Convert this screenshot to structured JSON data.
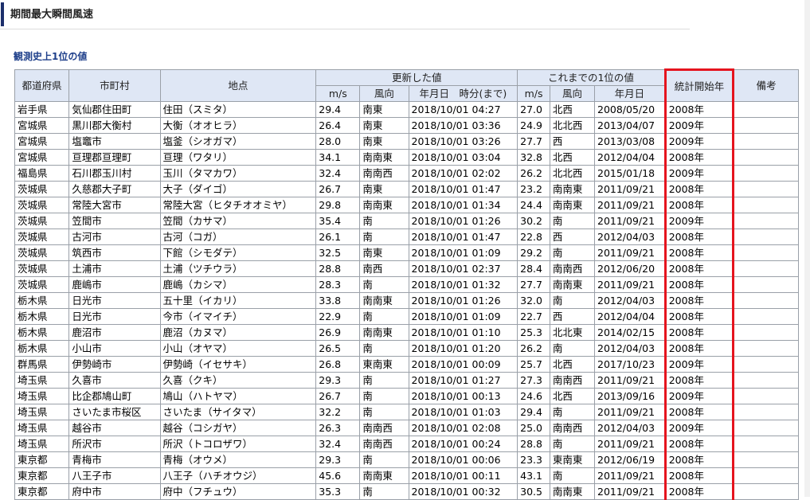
{
  "page": {
    "title": "期間最大瞬間風速",
    "section_title": "観測史上1位の値"
  },
  "colors": {
    "header_bg": "#dfe7f5",
    "title_accent": "#1c2f6b",
    "section_title": "#1e3f8a",
    "highlight": "#e5141e"
  },
  "table": {
    "headers": {
      "prefecture": "都道府県",
      "city": "市町村",
      "station": "地点",
      "updated_group": "更新した値",
      "previous_group": "これまでの1位の値",
      "start_year": "統計開始年",
      "remarks": "備考",
      "updated_speed": "m/s",
      "updated_direction": "風向",
      "updated_datetime": "年月日　時分(まで)",
      "previous_speed": "m/s",
      "previous_direction": "風向",
      "previous_date": "年月日"
    },
    "rows": [
      {
        "prefecture": "岩手県",
        "city": "気仙郡住田町",
        "station": "住田（スミタ）",
        "speed": "29.4",
        "direction": "南東",
        "datetime": "2018/10/01 04:27",
        "prev_speed": "27.0",
        "prev_direction": "北西",
        "prev_date": "2008/05/20",
        "start_year": "2008年",
        "remarks": ""
      },
      {
        "prefecture": "宮城県",
        "city": "黒川郡大衡村",
        "station": "大衡（オオヒラ）",
        "speed": "26.4",
        "direction": "南東",
        "datetime": "2018/10/01 03:36",
        "prev_speed": "24.9",
        "prev_direction": "北北西",
        "prev_date": "2013/04/07",
        "start_year": "2009年",
        "remarks": ""
      },
      {
        "prefecture": "宮城県",
        "city": "塩竈市",
        "station": "塩釜（シオガマ）",
        "speed": "28.0",
        "direction": "南東",
        "datetime": "2018/10/01 03:26",
        "prev_speed": "27.7",
        "prev_direction": "西",
        "prev_date": "2013/03/08",
        "start_year": "2009年",
        "remarks": ""
      },
      {
        "prefecture": "宮城県",
        "city": "亘理郡亘理町",
        "station": "亘理（ワタリ）",
        "speed": "34.1",
        "direction": "南南東",
        "datetime": "2018/10/01 03:04",
        "prev_speed": "32.8",
        "prev_direction": "北西",
        "prev_date": "2012/04/04",
        "start_year": "2008年",
        "remarks": ""
      },
      {
        "prefecture": "福島県",
        "city": "石川郡玉川村",
        "station": "玉川（タマカワ）",
        "speed": "32.4",
        "direction": "南南西",
        "datetime": "2018/10/01 02:02",
        "prev_speed": "26.2",
        "prev_direction": "北北西",
        "prev_date": "2015/01/18",
        "start_year": "2009年",
        "remarks": ""
      },
      {
        "prefecture": "茨城県",
        "city": "久慈郡大子町",
        "station": "大子（ダイゴ）",
        "speed": "26.7",
        "direction": "南東",
        "datetime": "2018/10/01 01:47",
        "prev_speed": "23.2",
        "prev_direction": "南南東",
        "prev_date": "2011/09/21",
        "start_year": "2008年",
        "remarks": ""
      },
      {
        "prefecture": "茨城県",
        "city": "常陸大宮市",
        "station": "常陸大宮（ヒタチオオミヤ）",
        "speed": "29.8",
        "direction": "南南東",
        "datetime": "2018/10/01 01:34",
        "prev_speed": "24.4",
        "prev_direction": "南南東",
        "prev_date": "2011/09/21",
        "start_year": "2008年",
        "remarks": ""
      },
      {
        "prefecture": "茨城県",
        "city": "笠間市",
        "station": "笠間（カサマ）",
        "speed": "35.4",
        "direction": "南",
        "datetime": "2018/10/01 01:26",
        "prev_speed": "30.2",
        "prev_direction": "南",
        "prev_date": "2011/09/21",
        "start_year": "2009年",
        "remarks": ""
      },
      {
        "prefecture": "茨城県",
        "city": "古河市",
        "station": "古河（コガ）",
        "speed": "26.1",
        "direction": "南",
        "datetime": "2018/10/01 01:47",
        "prev_speed": "22.8",
        "prev_direction": "西",
        "prev_date": "2012/04/03",
        "start_year": "2008年",
        "remarks": ""
      },
      {
        "prefecture": "茨城県",
        "city": "筑西市",
        "station": "下館（シモダテ）",
        "speed": "32.5",
        "direction": "南東",
        "datetime": "2018/10/01 01:09",
        "prev_speed": "29.2",
        "prev_direction": "南",
        "prev_date": "2011/09/21",
        "start_year": "2008年",
        "remarks": ""
      },
      {
        "prefecture": "茨城県",
        "city": "土浦市",
        "station": "土浦（ツチウラ）",
        "speed": "28.8",
        "direction": "南西",
        "datetime": "2018/10/01 02:37",
        "prev_speed": "28.4",
        "prev_direction": "南南西",
        "prev_date": "2012/06/20",
        "start_year": "2008年",
        "remarks": ""
      },
      {
        "prefecture": "茨城県",
        "city": "鹿嶋市",
        "station": "鹿嶋（カシマ）",
        "speed": "28.3",
        "direction": "南",
        "datetime": "2018/10/01 01:32",
        "prev_speed": "27.7",
        "prev_direction": "南南東",
        "prev_date": "2011/09/21",
        "start_year": "2008年",
        "remarks": ""
      },
      {
        "prefecture": "栃木県",
        "city": "日光市",
        "station": "五十里（イカリ）",
        "speed": "33.8",
        "direction": "南南東",
        "datetime": "2018/10/01 01:26",
        "prev_speed": "32.0",
        "prev_direction": "南",
        "prev_date": "2012/04/03",
        "start_year": "2008年",
        "remarks": ""
      },
      {
        "prefecture": "栃木県",
        "city": "日光市",
        "station": "今市（イマイチ）",
        "speed": "22.9",
        "direction": "南",
        "datetime": "2018/10/01 01:09",
        "prev_speed": "22.7",
        "prev_direction": "西",
        "prev_date": "2012/04/04",
        "start_year": "2008年",
        "remarks": ""
      },
      {
        "prefecture": "栃木県",
        "city": "鹿沼市",
        "station": "鹿沼（カヌマ）",
        "speed": "26.9",
        "direction": "南南東",
        "datetime": "2018/10/01 01:10",
        "prev_speed": "25.3",
        "prev_direction": "北北東",
        "prev_date": "2014/02/15",
        "start_year": "2008年",
        "remarks": ""
      },
      {
        "prefecture": "栃木県",
        "city": "小山市",
        "station": "小山（オヤマ）",
        "speed": "26.5",
        "direction": "南",
        "datetime": "2018/10/01 01:20",
        "prev_speed": "26.2",
        "prev_direction": "南",
        "prev_date": "2012/04/03",
        "start_year": "2008年",
        "remarks": ""
      },
      {
        "prefecture": "群馬県",
        "city": "伊勢崎市",
        "station": "伊勢崎（イセサキ）",
        "speed": "26.8",
        "direction": "東南東",
        "datetime": "2018/10/01 00:09",
        "prev_speed": "25.7",
        "prev_direction": "北西",
        "prev_date": "2017/10/23",
        "start_year": "2009年",
        "remarks": ""
      },
      {
        "prefecture": "埼玉県",
        "city": "久喜市",
        "station": "久喜（クキ）",
        "speed": "29.3",
        "direction": "南",
        "datetime": "2018/10/01 01:27",
        "prev_speed": "27.3",
        "prev_direction": "南南西",
        "prev_date": "2011/09/21",
        "start_year": "2008年",
        "remarks": ""
      },
      {
        "prefecture": "埼玉県",
        "city": "比企郡鳩山町",
        "station": "鳩山（ハトヤマ）",
        "speed": "26.7",
        "direction": "南",
        "datetime": "2018/10/01 00:13",
        "prev_speed": "24.6",
        "prev_direction": "北西",
        "prev_date": "2013/09/16",
        "start_year": "2009年",
        "remarks": ""
      },
      {
        "prefecture": "埼玉県",
        "city": "さいたま市桜区",
        "station": "さいたま（サイタマ）",
        "speed": "32.2",
        "direction": "南",
        "datetime": "2018/10/01 01:03",
        "prev_speed": "29.4",
        "prev_direction": "南",
        "prev_date": "2011/09/21",
        "start_year": "2008年",
        "remarks": ""
      },
      {
        "prefecture": "埼玉県",
        "city": "越谷市",
        "station": "越谷（コシガヤ）",
        "speed": "26.3",
        "direction": "南南西",
        "datetime": "2018/10/01 02:08",
        "prev_speed": "25.0",
        "prev_direction": "南南西",
        "prev_date": "2012/04/03",
        "start_year": "2009年",
        "remarks": ""
      },
      {
        "prefecture": "埼玉県",
        "city": "所沢市",
        "station": "所沢（トコロザワ）",
        "speed": "32.4",
        "direction": "南南西",
        "datetime": "2018/10/01 00:24",
        "prev_speed": "28.8",
        "prev_direction": "南",
        "prev_date": "2011/09/21",
        "start_year": "2008年",
        "remarks": ""
      },
      {
        "prefecture": "東京都",
        "city": "青梅市",
        "station": "青梅（オウメ）",
        "speed": "29.3",
        "direction": "南",
        "datetime": "2018/10/01 00:06",
        "prev_speed": "23.3",
        "prev_direction": "東南東",
        "prev_date": "2012/06/19",
        "start_year": "2008年",
        "remarks": ""
      },
      {
        "prefecture": "東京都",
        "city": "八王子市",
        "station": "八王子（ハチオウジ）",
        "speed": "45.6",
        "direction": "南南東",
        "datetime": "2018/10/01 00:11",
        "prev_speed": "43.1",
        "prev_direction": "南",
        "prev_date": "2011/09/21",
        "start_year": "2008年",
        "remarks": ""
      },
      {
        "prefecture": "東京都",
        "city": "府中市",
        "station": "府中（フチュウ）",
        "speed": "35.3",
        "direction": "南",
        "datetime": "2018/10/01 00:32",
        "prev_speed": "30.5",
        "prev_direction": "南南東",
        "prev_date": "2011/09/21",
        "start_year": "2008年",
        "remarks": ""
      }
    ]
  }
}
